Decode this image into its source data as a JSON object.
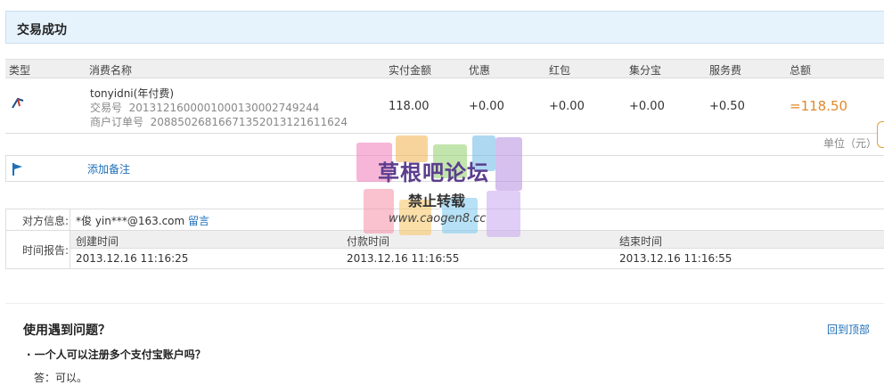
{
  "header": {
    "title": "交易成功"
  },
  "columns": [
    "类型",
    "消费名称",
    "实付金额",
    "优惠",
    "红包",
    "集分宝",
    "服务费",
    "总额"
  ],
  "order": {
    "name": "tonyidni(年付费)",
    "trade_no_label": "交易号",
    "trade_no": "2013121600001000130002749244",
    "merchant_no_label": "商户订单号",
    "merchant_no": "20885026816671352013121611624",
    "paid": "118.00",
    "discount": "+0.00",
    "red_packet": "+0.00",
    "jifenbao": "+0.00",
    "service_fee": "+0.50",
    "total": "=118.50"
  },
  "unit_label": "单位（元）",
  "note": {
    "add_label": "添加备注"
  },
  "counterparty": {
    "label": "对方信息:",
    "value": "*俊  yin***@163.com",
    "message_link": "留言"
  },
  "timeline": {
    "label": "时间报告:",
    "created_label": "创建时间",
    "paid_label": "付款时间",
    "finished_label": "结束时间",
    "created": "2013.12.16 11:16:25",
    "paid": "2013.12.16 11:16:55",
    "finished": "2013.12.16 11:16:55"
  },
  "help": {
    "title": "使用遇到问题？",
    "back_to_top": "回到顶部",
    "q1": "· 一个人可以注册多个支付宝账户吗？",
    "a1": "答：可以。"
  },
  "watermark": {
    "line1": "草根吧论坛",
    "line2": "禁止转载",
    "line3": "www.caogen8.cc"
  },
  "colors": {
    "accent": "#1d6fb8",
    "total": "#e08a2c",
    "header_bg": "#e6f3fd"
  }
}
